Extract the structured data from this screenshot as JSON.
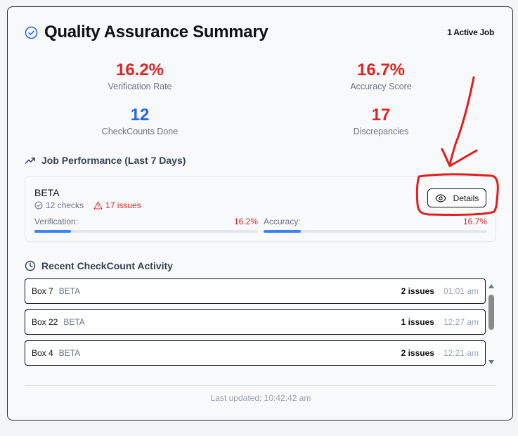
{
  "header": {
    "title": "Quality Assurance Summary",
    "active_jobs": "1 Active Job"
  },
  "stats": {
    "verification_rate": {
      "value": "16.2%",
      "label": "Verification Rate"
    },
    "accuracy_score": {
      "value": "16.7%",
      "label": "Accuracy Score"
    },
    "checkcounts_done": {
      "value": "12",
      "label": "CheckCounts Done"
    },
    "discrepancies": {
      "value": "17",
      "label": "Discrepancies"
    }
  },
  "job_performance": {
    "title": "Job Performance (Last 7 Days)",
    "job": {
      "name": "BETA",
      "checks": "12 checks",
      "issues": "17 issues",
      "details_label": "Details",
      "verification_label": "Verification:",
      "verification_value": "16.2%",
      "verification_fraction": 0.162,
      "accuracy_label": "Accuracy:",
      "accuracy_value": "16.7%",
      "accuracy_fraction": 0.167
    }
  },
  "recent_activity": {
    "title": "Recent CheckCount Activity",
    "items": [
      {
        "box": "Box 7",
        "job": "BETA",
        "issues": "2 issues",
        "time": "01:01 am"
      },
      {
        "box": "Box 22",
        "job": "BETA",
        "issues": "1 issues",
        "time": "12:27 am"
      },
      {
        "box": "Box 4",
        "job": "BETA",
        "issues": "2 issues",
        "time": "12:21 am"
      }
    ]
  },
  "footer": {
    "last_updated": "Last updated: 10:42:42 am"
  },
  "colors": {
    "negative": "#dc2626",
    "accent": "#2563eb",
    "bar_fill": "#3b82f6",
    "annotation": "#e11d1d"
  },
  "icons": {
    "title": "check-circle-icon",
    "job_performance": "trending-up-icon",
    "checks": "check-circle-icon",
    "issues": "alert-triangle-icon",
    "details": "eye-icon",
    "recent_activity": "clock-icon"
  }
}
